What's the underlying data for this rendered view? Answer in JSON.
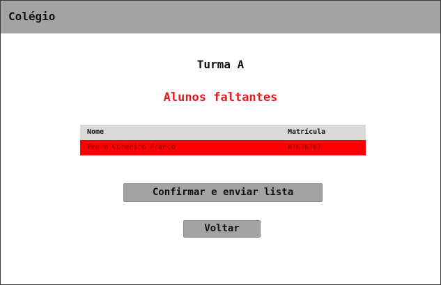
{
  "header": {
    "title": "Colégio"
  },
  "main": {
    "class_title": "Turma A",
    "section_title": "Alunos faltantes",
    "table": {
      "columns": {
        "name": "Nome",
        "id": "Matrícula"
      },
      "rows": [
        {
          "name": "Pedro Cordeiro Franco",
          "id": "87676767"
        }
      ]
    },
    "buttons": {
      "confirm": "Confirmar e enviar lista",
      "back": "Voltar"
    }
  },
  "colors": {
    "header_bg": "#a3a3a3",
    "accent_red": "#e02020",
    "row_highlight": "#ff0000",
    "table_header_bg": "#d9d9d9"
  }
}
